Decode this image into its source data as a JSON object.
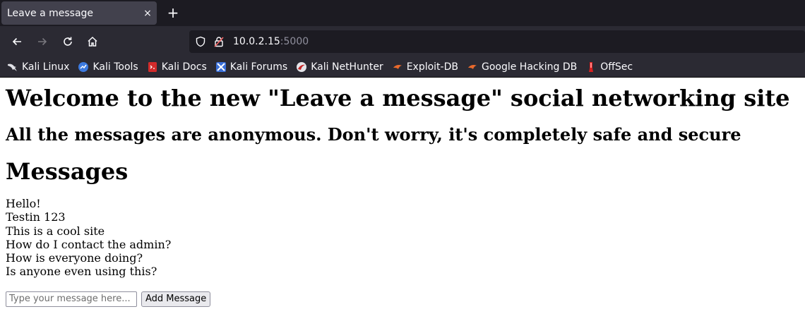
{
  "browser": {
    "tab": {
      "title": "Leave a message",
      "close": "×"
    },
    "new_tab": "+",
    "url": {
      "host": "10.0.2.15",
      "port": ":5000"
    },
    "bookmarks": [
      {
        "label": "Kali Linux",
        "icon": "kali-dragon-icon"
      },
      {
        "label": "Kali Tools",
        "icon": "kali-tools-icon"
      },
      {
        "label": "Kali Docs",
        "icon": "kali-docs-icon"
      },
      {
        "label": "Kali Forums",
        "icon": "kali-forums-icon"
      },
      {
        "label": "Kali NetHunter",
        "icon": "nethunter-icon"
      },
      {
        "label": "Exploit-DB",
        "icon": "exploit-db-icon"
      },
      {
        "label": "Google Hacking DB",
        "icon": "ghdb-icon"
      },
      {
        "label": "OffSec",
        "icon": "offsec-icon"
      }
    ]
  },
  "page": {
    "title": "Welcome to the new \"Leave a message\" social networking site",
    "subtitle": "All the messages are anonymous. Don't worry, it's completely safe and secure",
    "messages_heading": "Messages",
    "messages": [
      "Hello!",
      "Testin 123",
      "This is a cool site",
      "How do I contact the admin?",
      "How is everyone doing?",
      "Is anyone even using this?"
    ],
    "form": {
      "placeholder": "Type your message here...",
      "value": "",
      "submit_label": "Add Message"
    }
  }
}
